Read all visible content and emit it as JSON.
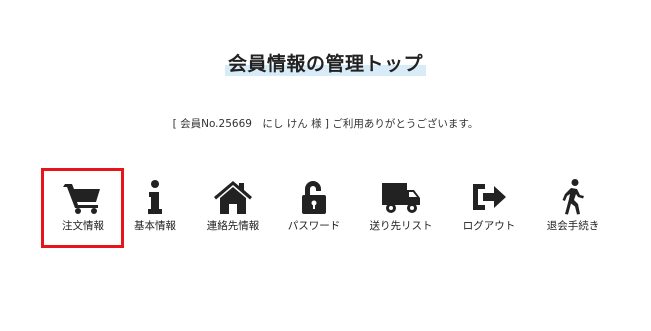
{
  "page": {
    "title": "会員情報の管理トップ",
    "member_info": "[ 会員No.25669　にし けん 様 ] ご利用ありがとうございます。"
  },
  "menu": {
    "items": [
      {
        "label": "注文情報",
        "icon": "cart-icon"
      },
      {
        "label": "基本情報",
        "icon": "info-icon"
      },
      {
        "label": "連絡先情報",
        "icon": "home-icon"
      },
      {
        "label": "パスワード",
        "icon": "unlock-icon"
      },
      {
        "label": "送り先リスト",
        "icon": "truck-icon"
      },
      {
        "label": "ログアウト",
        "icon": "sign-out-icon"
      },
      {
        "label": "退会手続き",
        "icon": "walking-icon"
      }
    ],
    "selected_index": 0
  },
  "colors": {
    "highlight_border": "#e8141b",
    "title_underline": "#d8ecf7",
    "icon": "#222222"
  }
}
